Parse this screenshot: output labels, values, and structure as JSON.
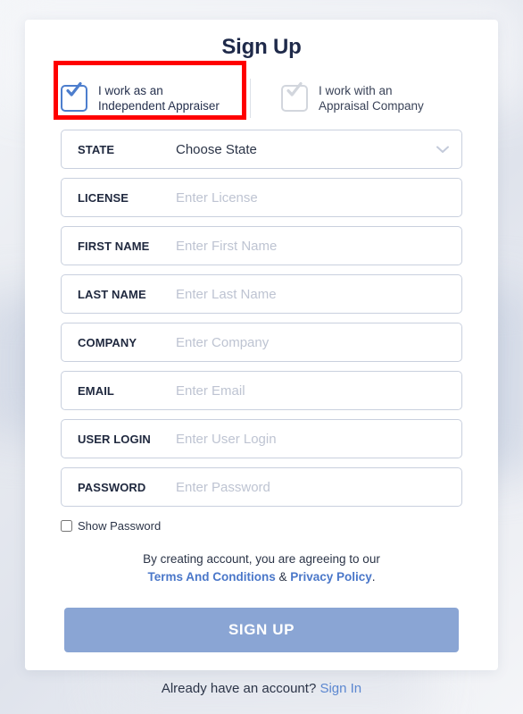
{
  "page": {
    "title": "Sign Up",
    "accent_color": "#8aa5d4",
    "link_color": "#4a77c9",
    "annotation_color": "#ff0000"
  },
  "roles": [
    {
      "line1": "I work as an",
      "line2": "Independent Appraiser",
      "checked": true,
      "icon": "checkbox-checked-icon"
    },
    {
      "line1": "I work with an",
      "line2": "Appraisal Company",
      "checked": false,
      "icon": "checkbox-unchecked-icon"
    }
  ],
  "fields": [
    {
      "label": "STATE",
      "value": "Choose State",
      "placeholder": "",
      "type": "select",
      "icon": "chevron-down-icon"
    },
    {
      "label": "LICENSE",
      "value": "",
      "placeholder": "Enter License",
      "type": "text"
    },
    {
      "label": "FIRST NAME",
      "value": "",
      "placeholder": "Enter First Name",
      "type": "text"
    },
    {
      "label": "LAST NAME",
      "value": "",
      "placeholder": "Enter Last Name",
      "type": "text"
    },
    {
      "label": "COMPANY",
      "value": "",
      "placeholder": "Enter Company",
      "type": "text"
    },
    {
      "label": "EMAIL",
      "value": "",
      "placeholder": "Enter Email",
      "type": "text"
    },
    {
      "label": "USER LOGIN",
      "value": "",
      "placeholder": "Enter User Login",
      "type": "text"
    },
    {
      "label": "PASSWORD",
      "value": "",
      "placeholder": "Enter Password",
      "type": "password"
    }
  ],
  "show_password": {
    "label": "Show Password",
    "checked": false
  },
  "terms": {
    "line1": "By creating account, you are agreeing to our",
    "link1": "Terms And Conditions",
    "separator": " & ",
    "link2": "Privacy Policy",
    "period": "."
  },
  "submit": {
    "label": "SIGN UP"
  },
  "footer": {
    "text": "Already have an account? ",
    "link": "Sign In"
  }
}
